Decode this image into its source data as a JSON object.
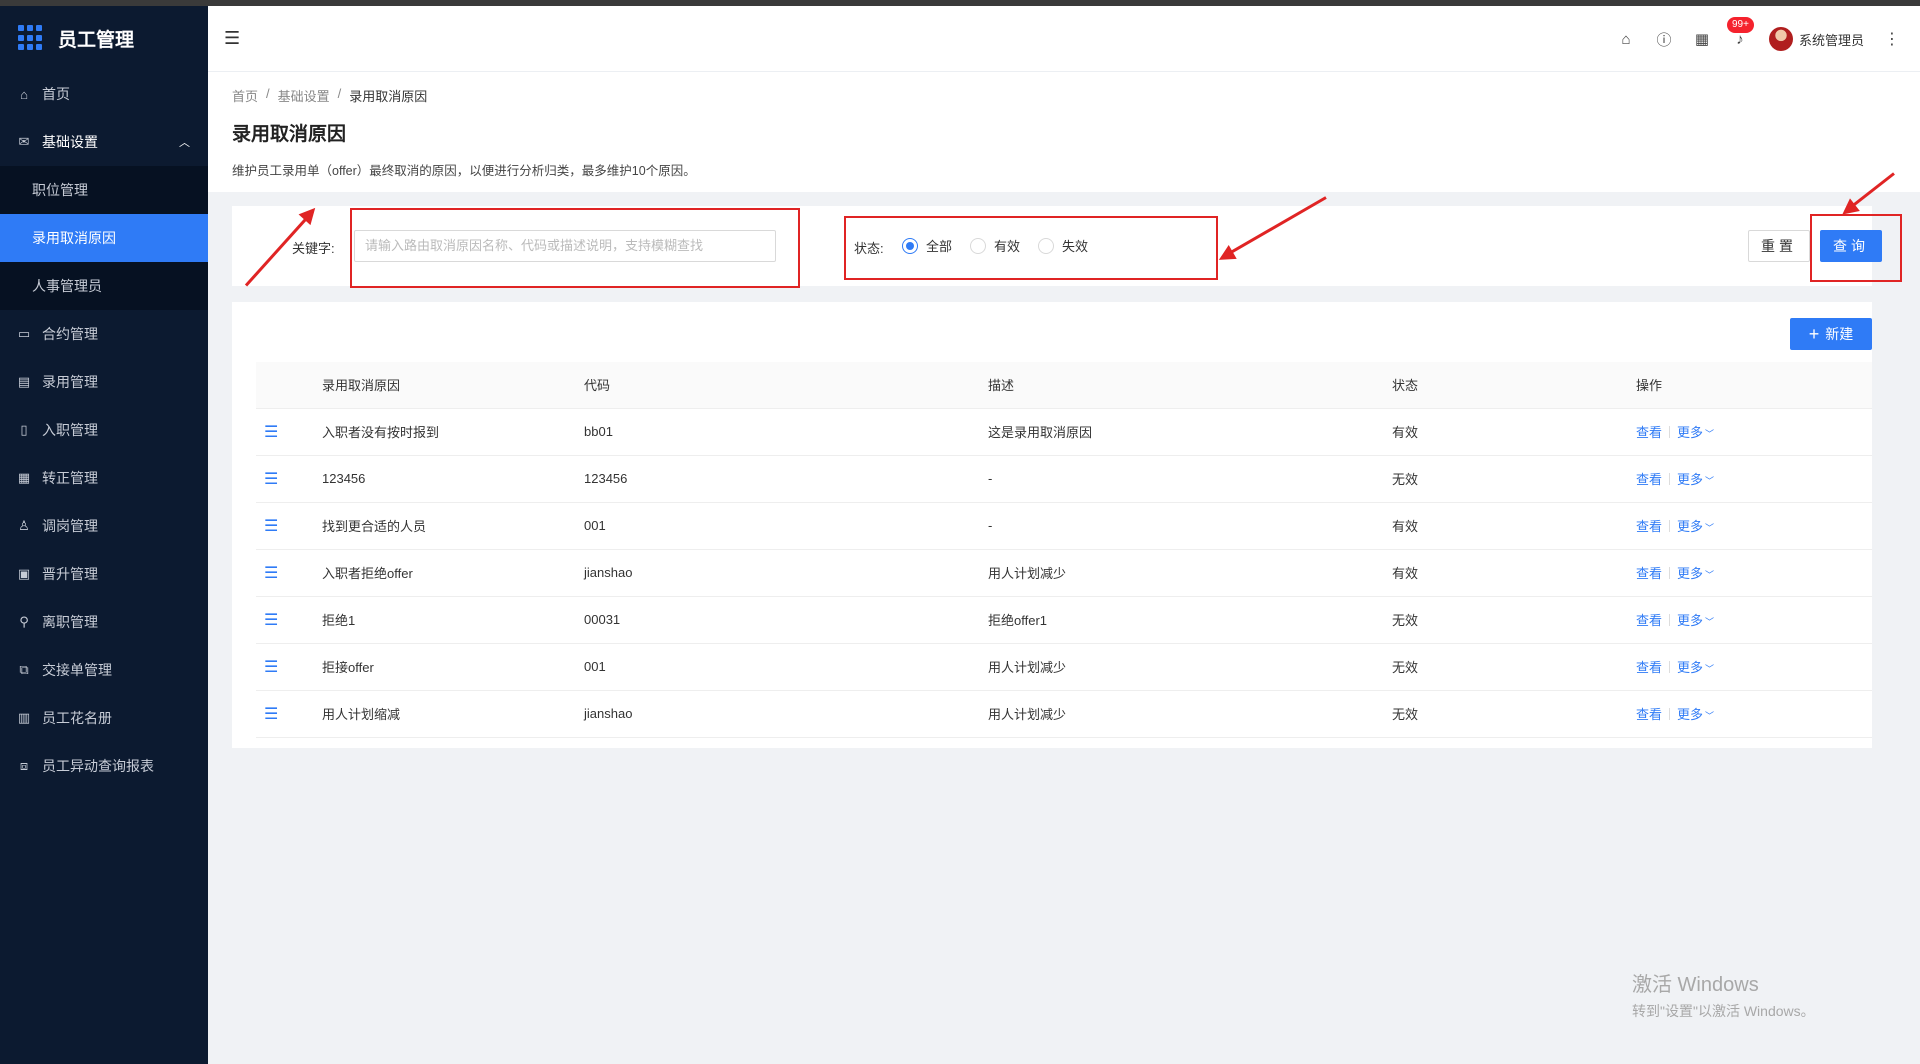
{
  "app": {
    "title": "员工管理"
  },
  "sidebar": {
    "items": [
      {
        "label": "首页",
        "icon": "home-icon"
      },
      {
        "label": "基础设置",
        "icon": "mail-icon",
        "open": true
      },
      {
        "label": "合约管理",
        "icon": "calendar-icon"
      },
      {
        "label": "录用管理",
        "icon": "card-icon"
      },
      {
        "label": "入职管理",
        "icon": "book-icon"
      },
      {
        "label": "转正管理",
        "icon": "grid-icon"
      },
      {
        "label": "调岗管理",
        "icon": "user-icon"
      },
      {
        "label": "晋升管理",
        "icon": "chart-icon"
      },
      {
        "label": "离职管理",
        "icon": "leave-icon"
      },
      {
        "label": "交接单管理",
        "icon": "copy-icon"
      },
      {
        "label": "员工花名册",
        "icon": "roster-icon"
      },
      {
        "label": "员工异动查询报表",
        "icon": "report-icon"
      }
    ],
    "submenu": [
      {
        "label": "职位管理"
      },
      {
        "label": "录用取消原因",
        "active": true
      },
      {
        "label": "人事管理员"
      }
    ]
  },
  "header": {
    "badge": "99+",
    "username": "系统管理员"
  },
  "breadcrumb": {
    "home": "首页",
    "parent": "基础设置",
    "current": "录用取消原因"
  },
  "page": {
    "title": "录用取消原因",
    "description": "维护员工录用单（offer）最终取消的原因，以便进行分析归类，最多维护10个原因。"
  },
  "filter": {
    "keyword_label": "关键字:",
    "keyword_placeholder": "请输入路由取消原因名称、代码或描述说明，支持模糊查找",
    "status_label": "状态:",
    "status_options": [
      "全部",
      "有效",
      "失效"
    ],
    "status_selected": "全部",
    "reset_label": "重置",
    "query_label": "查询"
  },
  "table": {
    "new_button": "新建",
    "columns": [
      "录用取消原因",
      "代码",
      "描述",
      "状态",
      "操作"
    ],
    "rows": [
      {
        "reason": "入职者没有按时报到",
        "code": "bb01",
        "desc": "这是录用取消原因",
        "status": "有效"
      },
      {
        "reason": "123456",
        "code": "123456",
        "desc": "-",
        "status": "无效"
      },
      {
        "reason": "找到更合适的人员",
        "code": "001",
        "desc": "-",
        "status": "有效"
      },
      {
        "reason": "入职者拒绝offer",
        "code": "jianshao",
        "desc": "用人计划减少",
        "status": "有效"
      },
      {
        "reason": "拒绝1",
        "code": "00031",
        "desc": "拒绝offer1",
        "status": "无效"
      },
      {
        "reason": "拒接offer",
        "code": "001",
        "desc": "用人计划减少",
        "status": "无效"
      },
      {
        "reason": "用人计划缩减",
        "code": "jianshao",
        "desc": "用人计划减少",
        "status": "无效"
      }
    ],
    "action_view": "查看",
    "action_more": "更多"
  },
  "watermark": {
    "line1": "激活 Windows",
    "line2": "转到\"设置\"以激活 Windows。"
  },
  "colors": {
    "sidebar_bg": "#0c1a30",
    "accent": "#2f7bf6",
    "annotation": "#e02424"
  }
}
